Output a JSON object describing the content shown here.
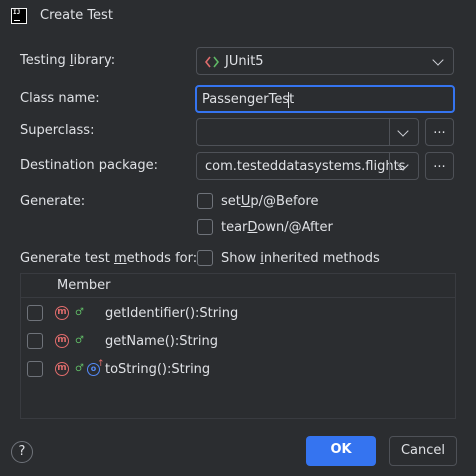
{
  "window": {
    "title": "Create Test",
    "app_icon_text": "IJ"
  },
  "form": {
    "testing_library": {
      "label_pre": "Testing ",
      "label_mn": "l",
      "label_post": "ibrary:",
      "value": "JUnit5",
      "icon": "junit-icon"
    },
    "class_name": {
      "label": "Class name:",
      "value": "PassengerTest"
    },
    "superclass": {
      "label": "Superclass:",
      "value": "",
      "browse_label": "..."
    },
    "destination_package": {
      "label": "Destination package:",
      "value": "com.testeddatasystems.flights",
      "browse_label": "..."
    },
    "generate": {
      "label": "Generate:",
      "options": [
        {
          "pre": "set",
          "mn": "U",
          "post": "p/@Before",
          "checked": false
        },
        {
          "pre": "tear",
          "mn": "D",
          "post": "own/@After",
          "checked": false
        }
      ]
    },
    "test_methods": {
      "label_pre": "Generate test ",
      "label_mn": "m",
      "label_post": "ethods for:",
      "show_inherited": {
        "pre": "Show ",
        "mn": "i",
        "post": "nherited methods",
        "checked": false
      }
    }
  },
  "members": {
    "header": "Member",
    "rows": [
      {
        "name": "getIdentifier():String",
        "checked": false,
        "icons": [
          "method-icon",
          "public-icon"
        ]
      },
      {
        "name": "getName():String",
        "checked": false,
        "icons": [
          "method-icon",
          "public-icon"
        ]
      },
      {
        "name": "toString():String",
        "checked": false,
        "icons": [
          "method-icon",
          "public-icon",
          "override-icon"
        ]
      }
    ]
  },
  "footer": {
    "help_label": "?",
    "ok_label": "OK",
    "cancel_label": "Cancel"
  },
  "colors": {
    "background": "#2b2d30",
    "accent": "#3574f0",
    "text": "#dfe1e5",
    "method_icon": "#e06c6c",
    "public_icon": "#5fb865",
    "override_icon": "#548af7"
  }
}
